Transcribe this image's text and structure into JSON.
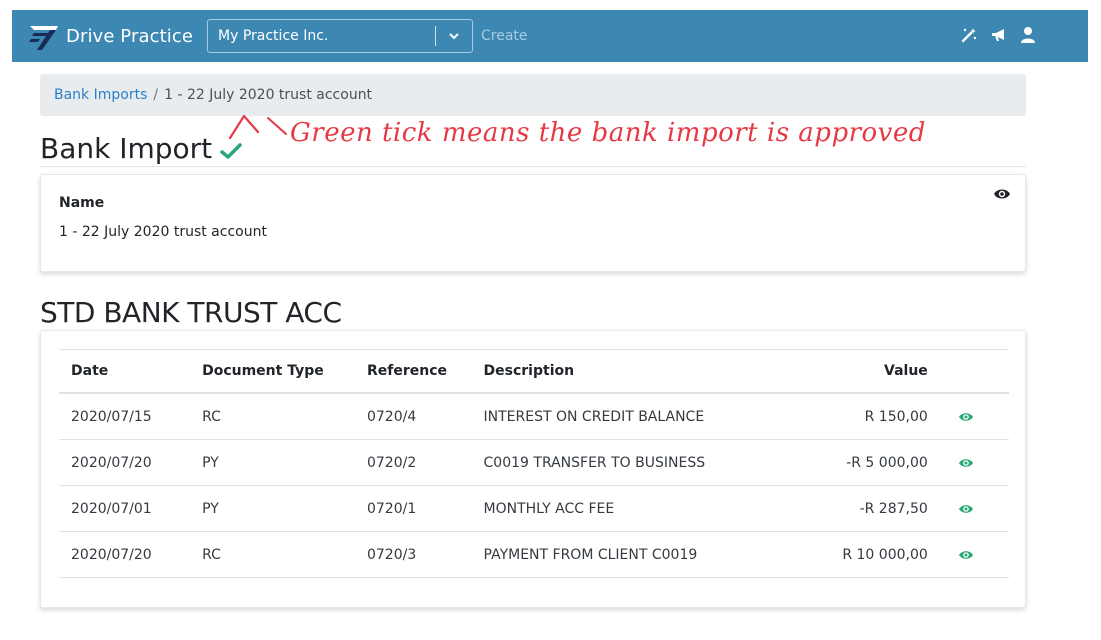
{
  "navbar": {
    "brand": "Drive Practice",
    "company": "My Practice Inc.",
    "create_label": "Create",
    "icons": [
      "magic-wand-icon",
      "megaphone-icon",
      "user-icon"
    ],
    "background": "#3d87b3"
  },
  "breadcrumb": {
    "link": "Bank Imports",
    "separator": "/",
    "current": "1 - 22 July 2020 trust account"
  },
  "page": {
    "title": "Bank Import",
    "status_icon": "check-icon",
    "status_color": "#28a876"
  },
  "annotation": {
    "text": "Green tick means the bank import is approved",
    "color": "#e63946"
  },
  "details": {
    "name_label": "Name",
    "name_value": "1 - 22 July 2020 trust account"
  },
  "account": {
    "title": "STD BANK TRUST ACC",
    "columns": {
      "date": "Date",
      "type": "Document Type",
      "ref": "Reference",
      "desc": "Description",
      "value": "Value"
    },
    "rows": [
      {
        "date": "2020/07/15",
        "type": "RC",
        "ref": "0720/4",
        "desc": "INTEREST ON CREDIT BALANCE",
        "value": "R 150,00"
      },
      {
        "date": "2020/07/20",
        "type": "PY",
        "ref": "0720/2",
        "desc": "C0019 TRANSFER TO BUSINESS",
        "value": "-R 5 000,00"
      },
      {
        "date": "2020/07/01",
        "type": "PY",
        "ref": "0720/1",
        "desc": "MONTHLY ACC FEE",
        "value": "-R 287,50"
      },
      {
        "date": "2020/07/20",
        "type": "RC",
        "ref": "0720/3",
        "desc": "PAYMENT FROM CLIENT C0019",
        "value": "R 10 000,00"
      }
    ]
  }
}
